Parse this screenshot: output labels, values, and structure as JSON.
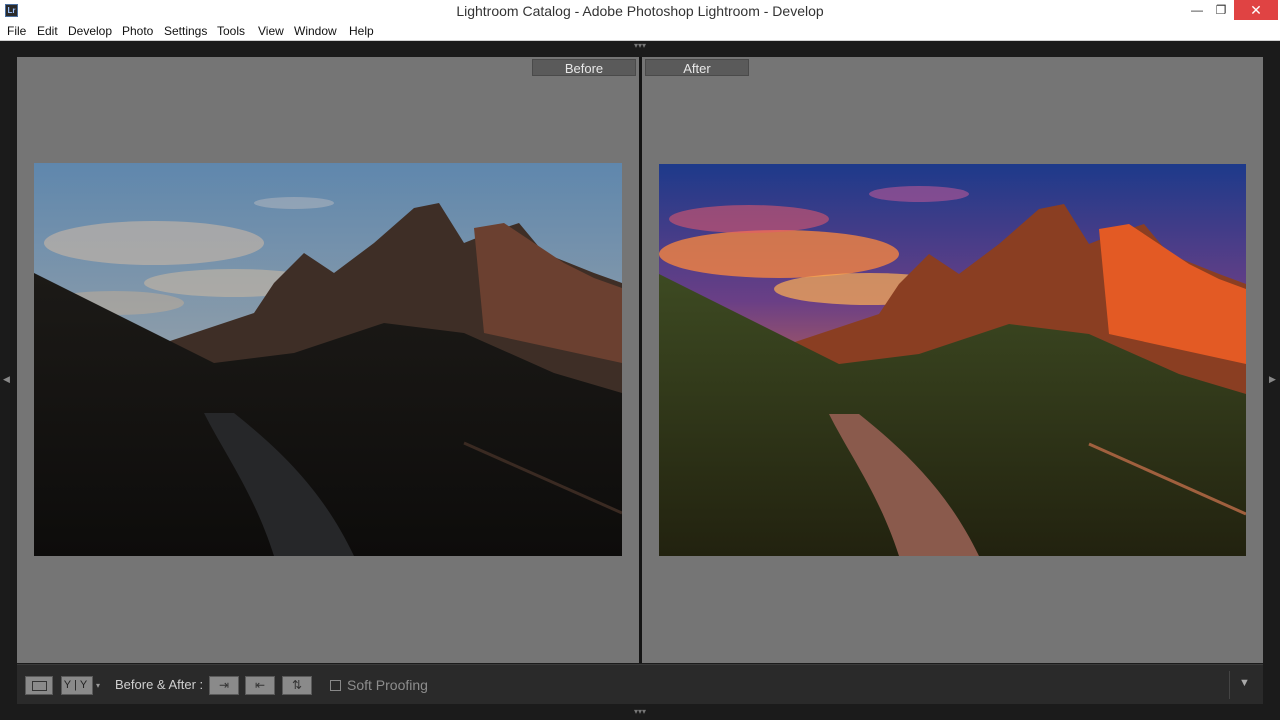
{
  "window": {
    "icon_text": "Lr",
    "title": "Lightroom Catalog - Adobe Photoshop Lightroom - Develop",
    "minimize": "—",
    "maximize": "❐",
    "close": "✕"
  },
  "menu": {
    "items": [
      {
        "label": "File"
      },
      {
        "label": "Edit"
      },
      {
        "label": "Develop"
      },
      {
        "label": "Photo"
      },
      {
        "label": "Settings"
      },
      {
        "label": "Tools"
      },
      {
        "label": "View"
      },
      {
        "label": "Window"
      },
      {
        "label": "Help"
      }
    ]
  },
  "compare": {
    "before_label": "Before",
    "after_label": "After"
  },
  "toolbar": {
    "view_yy": "Y|Y",
    "caret": "▾",
    "before_after_label": "Before & After :",
    "copy_right_icon": "⇥",
    "copy_left_icon": "⇤",
    "swap_icon": "⇅",
    "soft_proofing_label": "Soft Proofing",
    "soft_proofing_checked": false,
    "menu_caret": "▼"
  },
  "panels": {
    "left_arrow": "◀",
    "right_arrow": "▶",
    "grip": "▾▾▾"
  },
  "colors": {
    "accent_close": "#e04343",
    "pane_bg": "#757575",
    "toolbar_bg": "#2a2a2a"
  }
}
